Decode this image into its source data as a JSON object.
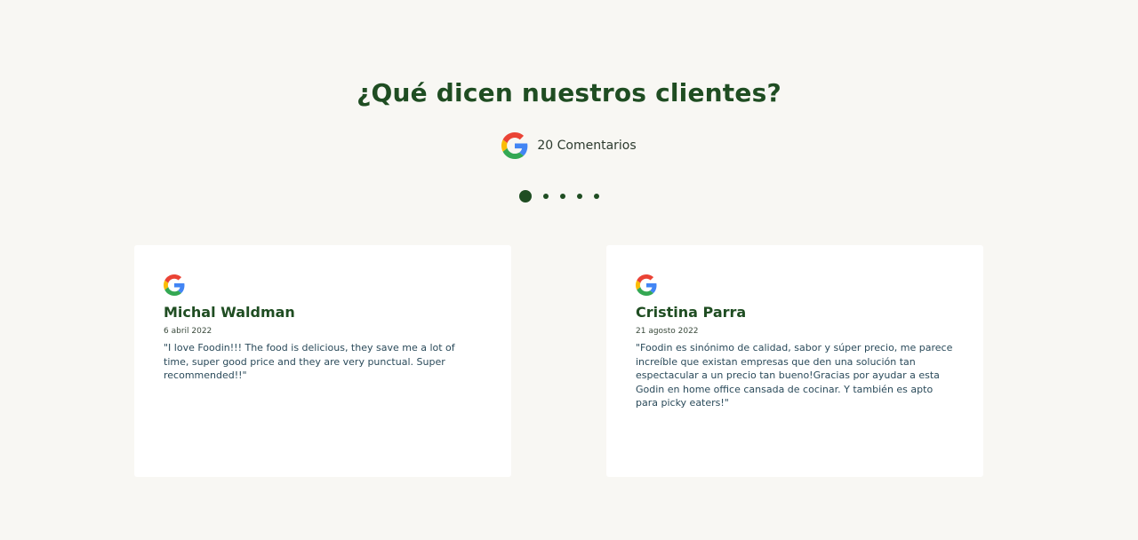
{
  "section": {
    "title": "¿Qué dicen nuestros clientes?",
    "review_count_label": "20 Comentarios"
  },
  "carousel": {
    "dots": 5,
    "active_index": 0
  },
  "reviews": [
    {
      "name": "Michal Waldman",
      "date": "6 abril 2022",
      "text": "\"I love Foodin!!! The food is delicious, they save me a lot of time, super good price and they are very punctual. Super recommended!!\"",
      "source_icon": "google-icon"
    },
    {
      "name": "Cristina Parra",
      "date": "21 agosto 2022",
      "text": "\"Foodin es sinónimo de calidad, sabor y súper precio, me parece increíble que existan empresas que den una solución tan espectacular a un precio tan bueno!Gracias por ayudar a esta Godin en home office cansada de cocinar. Y también es apto para picky eaters!\"",
      "source_icon": "google-icon"
    }
  ],
  "colors": {
    "background": "#f8f7f3",
    "accent_green": "#1f4d22",
    "card": "#ffffff"
  }
}
